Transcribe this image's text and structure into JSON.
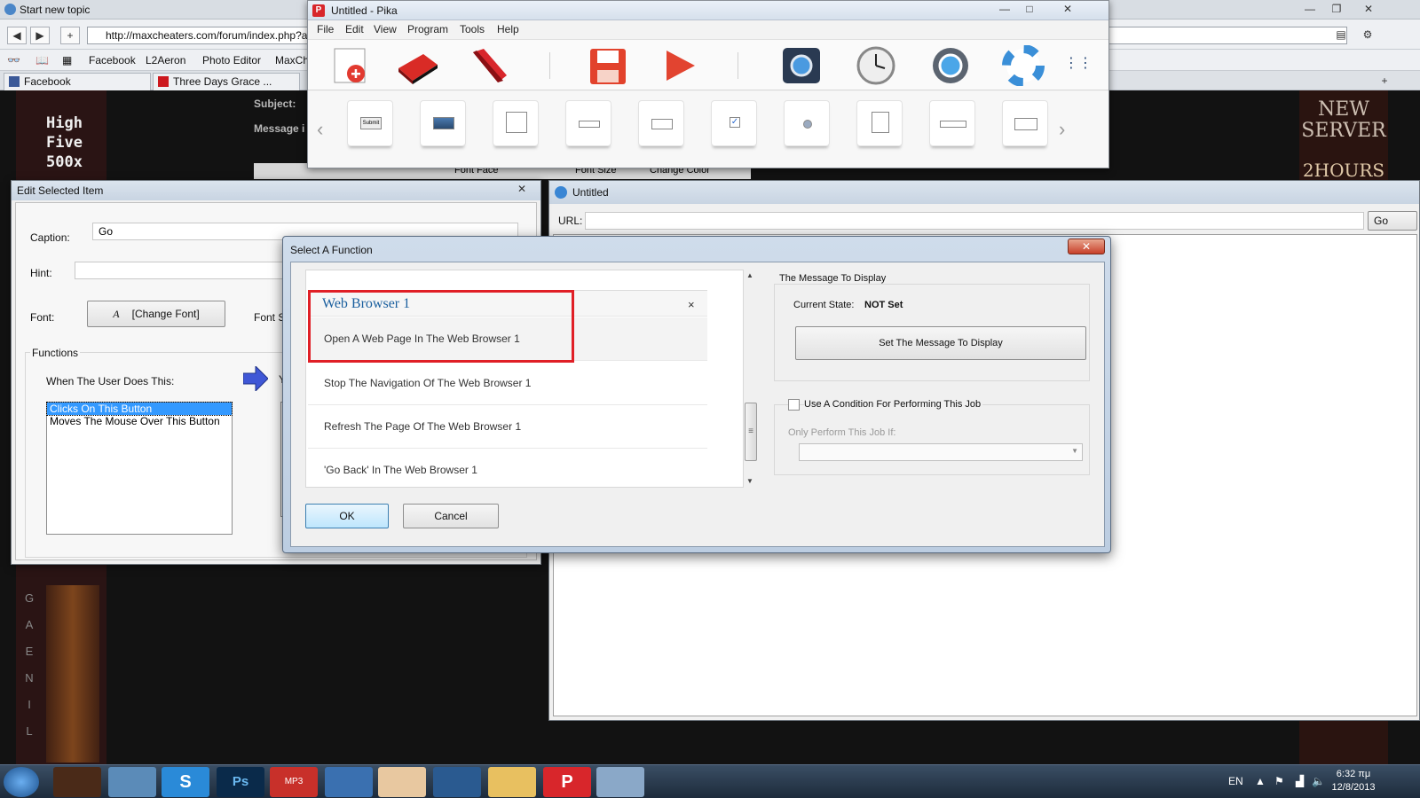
{
  "browser": {
    "tab_title": "Start new topic",
    "url": "http://maxcheaters.com/forum/index.php?a",
    "bookmarks": [
      "Facebook",
      "L2Aeron",
      "Photo Editor",
      "MaxChe"
    ],
    "tabs": [
      "Facebook",
      "Three Days Grace ..."
    ],
    "page": {
      "banner_left": [
        "High",
        "Five",
        "500x"
      ],
      "banner_right_top": "NEW SERVER",
      "banner_right_bottom": "2HOURS",
      "subject_label": "Subject:",
      "message_label": "Message i",
      "vertical_letters": [
        "G",
        "A",
        "E",
        "N",
        "I",
        "L"
      ],
      "editor_toolbar": {
        "font_face": "Font Face",
        "font_size": "Font Size",
        "change_color": "Change Color"
      }
    }
  },
  "pika": {
    "title": "Untitled - Pika",
    "menu": [
      "File",
      "Edit",
      "View",
      "Program",
      "Tools",
      "Help"
    ],
    "window_controls": {
      "minimize": "—",
      "maximize": "□",
      "close": "✕"
    },
    "toolbar_icons": [
      "new-page-icon",
      "open-folder-icon",
      "stapler-icon",
      "save-disk-icon",
      "play-icon",
      "settings-panel-icon",
      "clock-icon",
      "gear-icon",
      "lifebuoy-icon",
      "grip-icon"
    ],
    "palette_items": [
      "submit-button-control",
      "image-control",
      "pen-control",
      "textbox-control",
      "label-box-control",
      "checkbox-control",
      "radio-control",
      "checklist-control",
      "dropdown-control",
      "spinner-control"
    ],
    "palette_submit_text": "Submit",
    "palette_arrows": {
      "prev": "‹",
      "next": "›"
    }
  },
  "edit_item": {
    "title": "Edit Selected Item",
    "close": "✕",
    "caption_label": "Caption:",
    "caption_value": "Go",
    "hint_label": "Hint:",
    "hint_value": "",
    "font_label": "Font:",
    "font_button": "[Change Font]",
    "font_size_label": "Font Si",
    "functions_label": "Functions",
    "when_label": "When The User Does This:",
    "events": [
      "Clicks On This Button",
      "Moves The Mouse Over This Button"
    ],
    "selected_event": 0,
    "you_label": "Y"
  },
  "untitled": {
    "title": "Untitled",
    "url_label": "URL:",
    "url_value": "",
    "go_button": "Go"
  },
  "select_function": {
    "title": "Select A Function",
    "close": "✕",
    "group_title": "Web Browser 1",
    "group_close": "×",
    "items": [
      "Open A Web Page In The Web Browser 1",
      "Stop The Navigation Of The Web Browser 1",
      "Refresh The Page Of The Web Browser 1",
      "'Go Back' In The Web Browser 1"
    ],
    "message_section": "The Message To Display",
    "current_state_label": "Current State:",
    "current_state_value": "NOT Set",
    "set_message_button": "Set The Message To Display",
    "condition_label": "Use A Condition For Performing This Job",
    "condition_checked": false,
    "only_perform_label": "Only Perform This Job If:",
    "ok_button": "OK",
    "cancel_button": "Cancel",
    "highlight_color": "#e01f26"
  },
  "taskbar": {
    "apps": [
      "lineage-icon",
      "notepad-icon",
      "skype-icon",
      "photoshop-icon",
      "mp3-icon",
      "safari-icon",
      "game-avatar-icon",
      "browser-icon",
      "explorer-folder-icon",
      "pika-icon",
      "paint-icon"
    ],
    "skype_letter": "S",
    "photoshop_text": "Ps",
    "mp3_text": "MP3",
    "pika_letter": "P",
    "language": "EN",
    "time": "6:32 πμ",
    "date": "12/8/2013"
  }
}
